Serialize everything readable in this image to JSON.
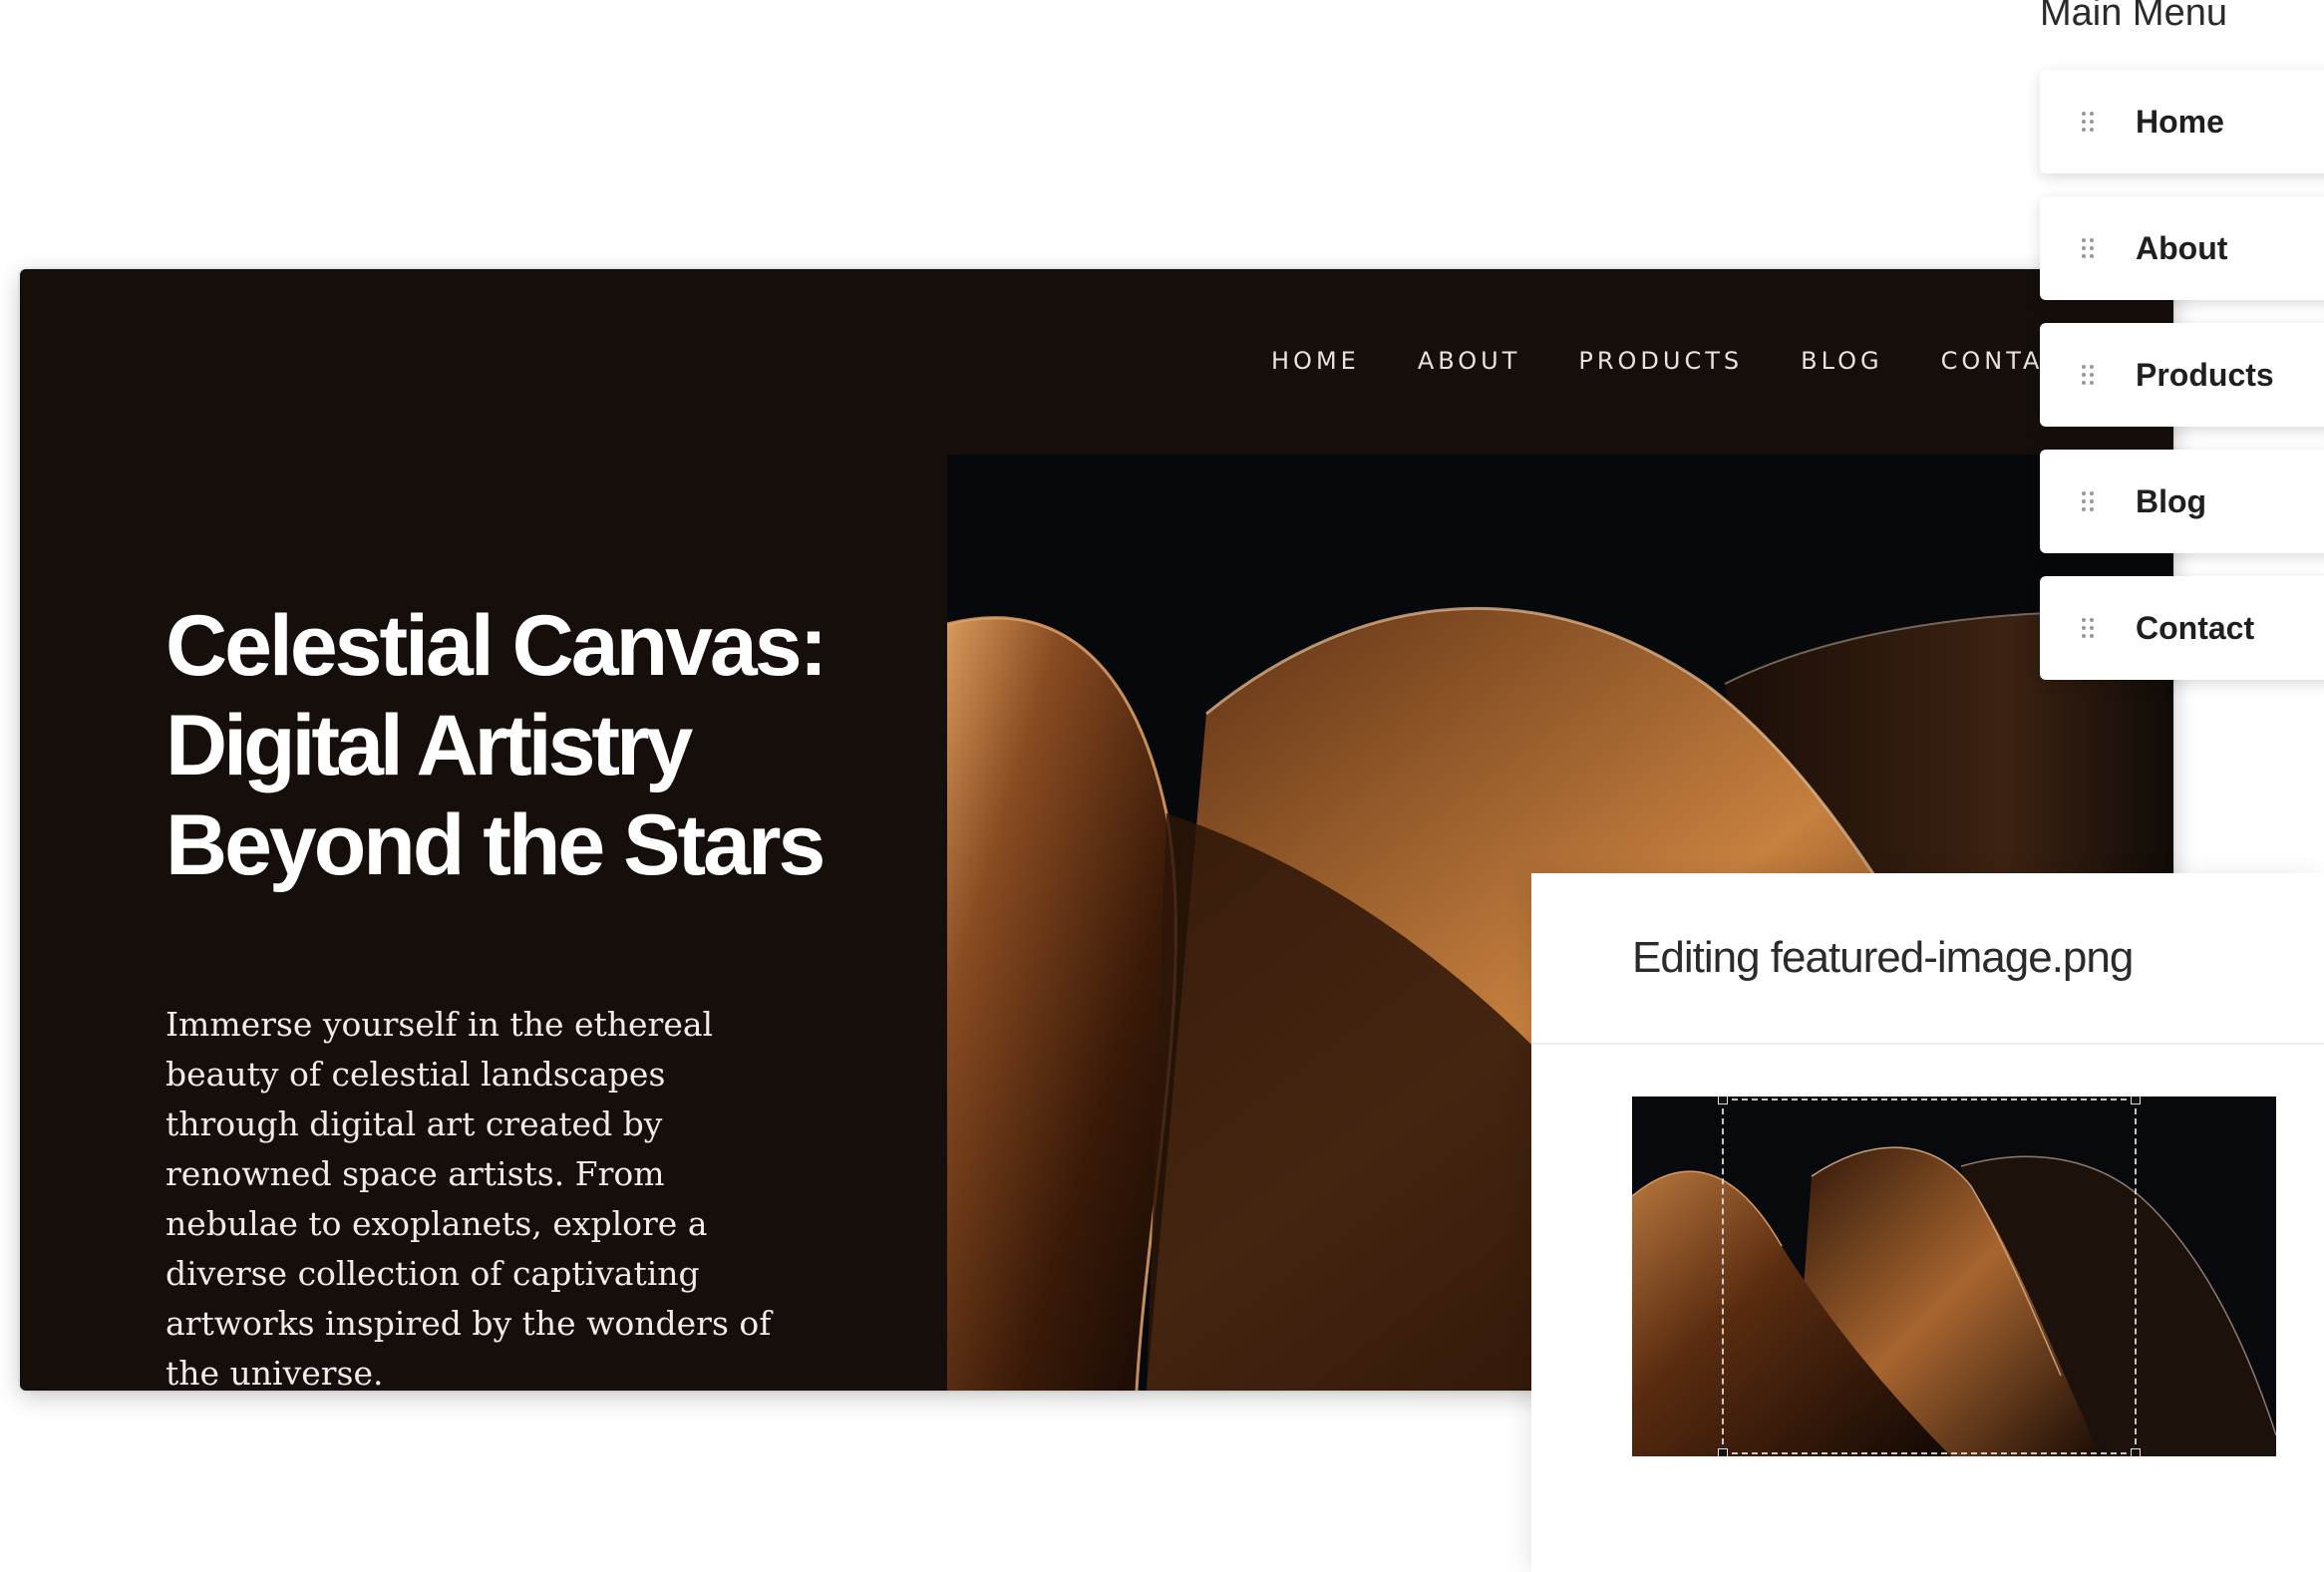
{
  "site": {
    "nav": [
      "HOME",
      "ABOUT",
      "PRODUCTS",
      "BLOG",
      "CONTACT"
    ],
    "hero": {
      "title_line1": "Celestial Canvas:",
      "title_line2": "Digital Artistry",
      "title_line3": "Beyond the Stars",
      "body": "Immerse yourself in the ethereal beauty of celestial landscapes through digital art created by renowned space artists. From nebulae to exoplanets, explore a diverse collection of captivating artworks inspired by the wonders of the universe."
    },
    "colors": {
      "background": "#150e0a",
      "accent_copper": "#c47a3e"
    }
  },
  "menu": {
    "title": "Main Menu",
    "items": [
      {
        "label": "Home"
      },
      {
        "label": "About"
      },
      {
        "label": "Products"
      },
      {
        "label": "Blog"
      },
      {
        "label": "Contact"
      }
    ],
    "handle_icon": "drag-handle-icon"
  },
  "editor": {
    "title": "Editing featured-image.png"
  }
}
